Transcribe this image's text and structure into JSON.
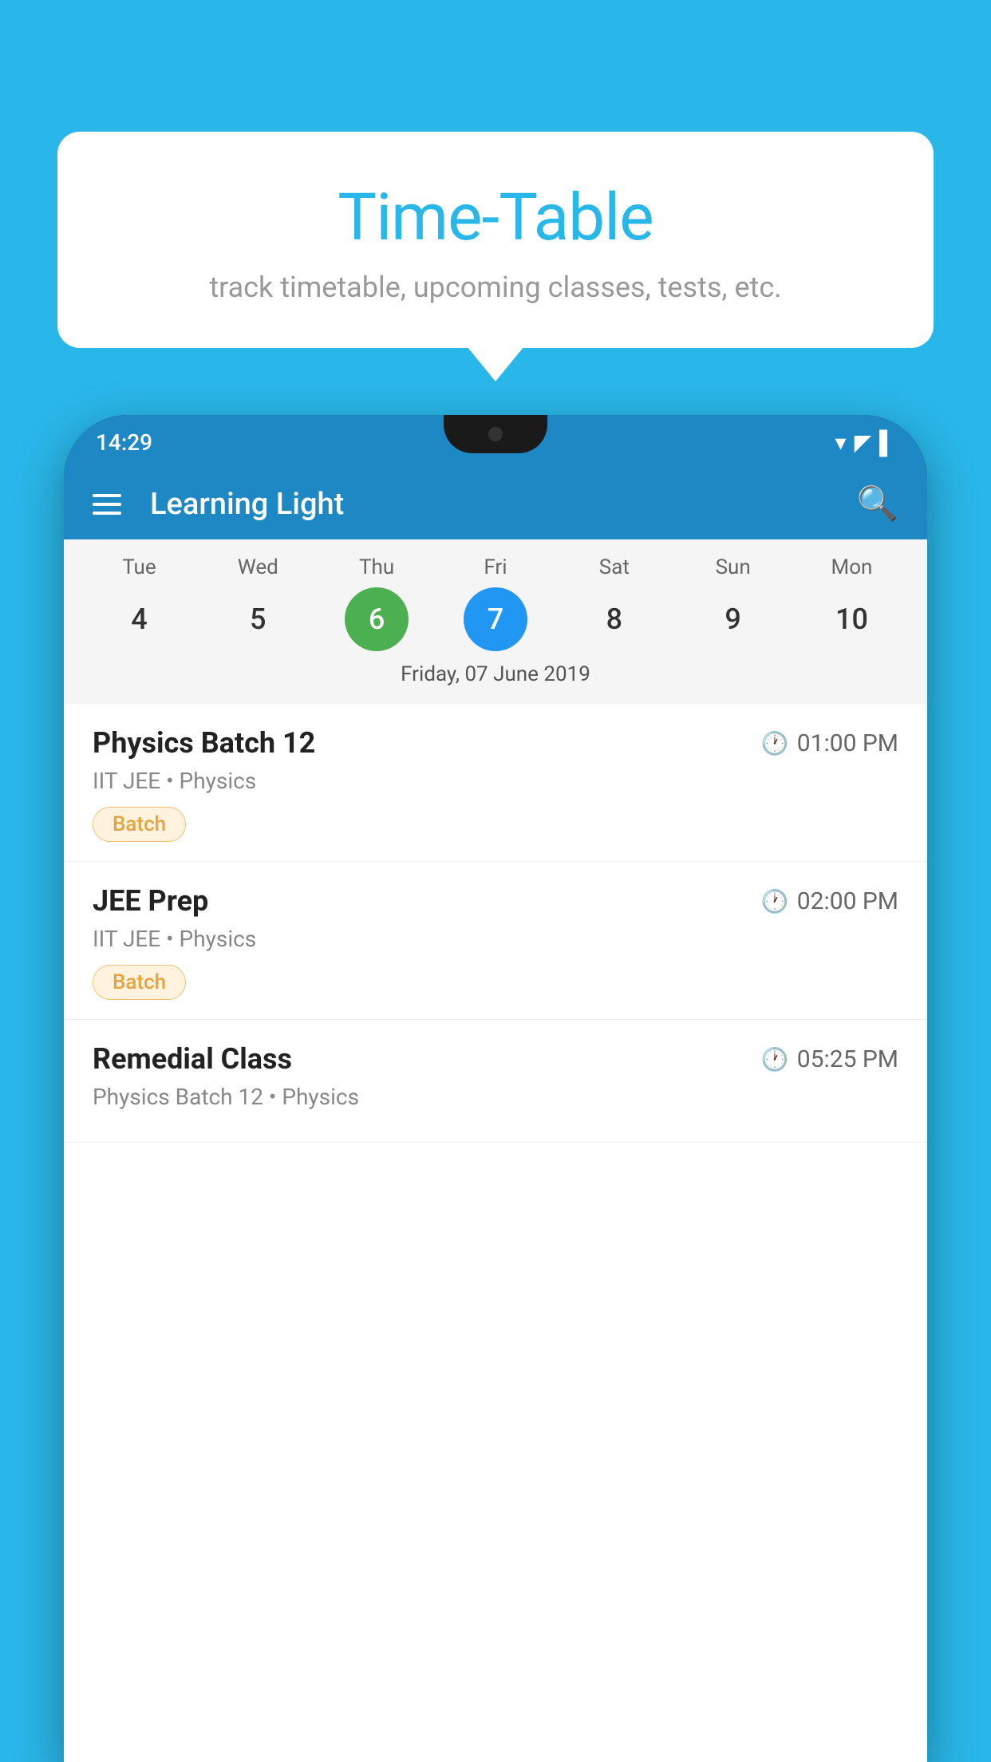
{
  "background_color": "#29b6e8",
  "tooltip": {
    "title": "Time-Table",
    "subtitle": "track timetable, upcoming classes, tests, etc."
  },
  "phone": {
    "status_bar": {
      "time": "14:29"
    },
    "app_bar": {
      "title": "Learning Light",
      "menu_label": "menu",
      "search_label": "search"
    },
    "calendar": {
      "days": [
        {
          "label": "Tue",
          "number": "4"
        },
        {
          "label": "Wed",
          "number": "5"
        },
        {
          "label": "Thu",
          "number": "6",
          "state": "today"
        },
        {
          "label": "Fri",
          "number": "7",
          "state": "selected"
        },
        {
          "label": "Sat",
          "number": "8"
        },
        {
          "label": "Sun",
          "number": "9"
        },
        {
          "label": "Mon",
          "number": "10"
        }
      ],
      "selected_date_label": "Friday, 07 June 2019"
    },
    "schedule": [
      {
        "title": "Physics Batch 12",
        "time": "01:00 PM",
        "subtitle": "IIT JEE • Physics",
        "badge": "Batch"
      },
      {
        "title": "JEE Prep",
        "time": "02:00 PM",
        "subtitle": "IIT JEE • Physics",
        "badge": "Batch"
      },
      {
        "title": "Remedial Class",
        "time": "05:25 PM",
        "subtitle": "Physics Batch 12 • Physics",
        "badge": null
      }
    ]
  }
}
